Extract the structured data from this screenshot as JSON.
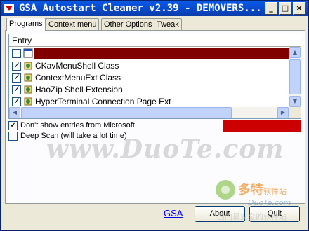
{
  "window": {
    "title": "GSA Autostart Cleaner v2.39 - DEMOVERS...",
    "controls": [
      "_",
      "□",
      "×"
    ]
  },
  "tabs": [
    {
      "label": "Programs",
      "active": true
    },
    {
      "label": "Context menu",
      "active": false
    },
    {
      "label": "Other Options",
      "active": false
    },
    {
      "label": "Tweak",
      "active": false
    }
  ],
  "list": {
    "header": "Entry",
    "rows": [
      {
        "label": "",
        "checked": false,
        "selected": true
      },
      {
        "label": "CKavMenuShell Class",
        "checked": true,
        "selected": false
      },
      {
        "label": "ContextMenuExt Class",
        "checked": true,
        "selected": false
      },
      {
        "label": "HaoZip Shell Extension",
        "checked": true,
        "selected": false
      },
      {
        "label": "HyperTerminal Connection Page Ext",
        "checked": true,
        "selected": false
      }
    ]
  },
  "options": [
    {
      "label": "Don't show entries from Microsoft",
      "checked": true
    },
    {
      "label": "Deep Scan (will take a lot time)",
      "checked": false
    }
  ],
  "status_text": "",
  "watermark": "www.DuoTe.com",
  "footer": {
    "link": "GSA",
    "about_button": "About",
    "quit_button": "Quit"
  },
  "logo_watermark": {
    "brand": "多特软件站",
    "url": "DuoTe.com",
    "slogan": "国内最安全的软件站"
  },
  "colors": {
    "title_bar": "#0a5ae8",
    "selection": "#800000",
    "status_red": "#cc0000",
    "link": "#0000ff"
  }
}
